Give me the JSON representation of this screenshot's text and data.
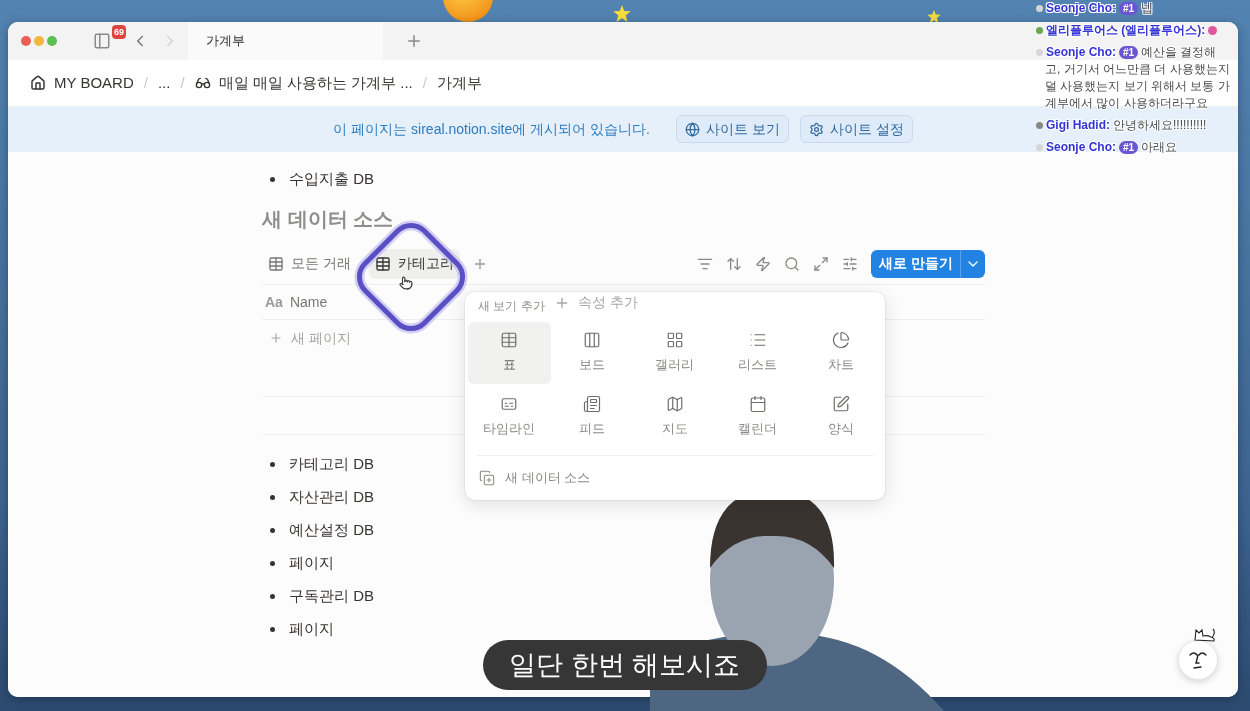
{
  "browser": {
    "sidebar_badge": "69",
    "nav_buttons": [
      {
        "kind": "back",
        "disabled": false
      },
      {
        "kind": "forward",
        "disabled": true
      }
    ],
    "tabs": [
      {
        "title": "가계부"
      }
    ]
  },
  "breadcrumb": [
    {
      "kind": "workspace",
      "label": "MY BOARD"
    },
    {
      "kind": "separator",
      "label": "/"
    },
    {
      "kind": "text",
      "label": "..."
    },
    {
      "kind": "separator",
      "label": "/"
    },
    {
      "kind": "page",
      "label": "매일 매일 사용하는 가계부 ..."
    },
    {
      "kind": "separator",
      "label": "/"
    },
    {
      "kind": "text",
      "label": "가계부"
    }
  ],
  "banner": {
    "text": "이 페이지는 sireal.notion.site에 게시되어 있습니다.",
    "buttons": [
      {
        "kind": "view",
        "label": "사이트 보기"
      },
      {
        "kind": "settings",
        "label": "사이트 설정"
      }
    ]
  },
  "page": {
    "bullets_top": [
      "수입지출 DB"
    ],
    "database": {
      "placeholder": "새 데이터 소스",
      "views": [
        {
          "label": "모든 거래",
          "selected": false
        },
        {
          "label": "카테고리",
          "selected": true
        }
      ],
      "new_button": "새로 만들기",
      "columns": [
        {
          "type_glyph": "Aa",
          "label": "Name"
        }
      ],
      "add_property": "속성 추가",
      "new_page": "새 페이지"
    },
    "view_menu": {
      "title": "새 보기 추가",
      "options": [
        {
          "kind": "table",
          "label": "표",
          "selected": true
        },
        {
          "kind": "board",
          "label": "보드",
          "selected": false
        },
        {
          "kind": "gallery",
          "label": "갤러리",
          "selected": false
        },
        {
          "kind": "list",
          "label": "리스트",
          "selected": false
        },
        {
          "kind": "chart",
          "label": "차트",
          "selected": false
        },
        {
          "kind": "timeline",
          "label": "타임라인",
          "selected": false
        },
        {
          "kind": "feed",
          "label": "피드",
          "selected": false
        },
        {
          "kind": "map",
          "label": "지도",
          "selected": false
        },
        {
          "kind": "calendar",
          "label": "캘린더",
          "selected": false
        },
        {
          "kind": "form",
          "label": "양식",
          "selected": false
        }
      ],
      "footer": "새 데이터 소스"
    },
    "bullets_bottom": [
      "카테고리 DB",
      "자산관리 DB",
      "예산설정 DB",
      "페이지",
      "구독관리 DB",
      "페이지"
    ]
  },
  "chat": [
    {
      "name": "Seonje Cho:",
      "badge": "#1",
      "color": "#d6d6d6",
      "has_emote": false,
      "lines": [
        "넵"
      ]
    },
    {
      "name": "엘리플루어스 (엘리플루어스):",
      "color": "#6aa84f",
      "has_emote": true
    },
    {
      "name": "Seonje Cho:",
      "badge": "#1",
      "color": "#d6d6d6",
      "has_emote": false,
      "lines": [
        "예산을 결정해",
        "고, 거기서 어느만큼 더 사용했는지",
        "덜 사용했는지 보기 위해서 보통 가",
        "계부에서 많이 사용하더라구요"
      ]
    },
    {
      "name": "Gigi Hadid:",
      "color": "#888888",
      "has_emote": false,
      "lines": [
        "안녕하세요!!!!!!!!!!"
      ]
    },
    {
      "name": "Seonje Cho:",
      "badge": "#1",
      "color": "#d6d6d6",
      "has_emote": false,
      "lines": [
        "아래요"
      ]
    }
  ],
  "subtitle": "일단 한번 해보시죠"
}
